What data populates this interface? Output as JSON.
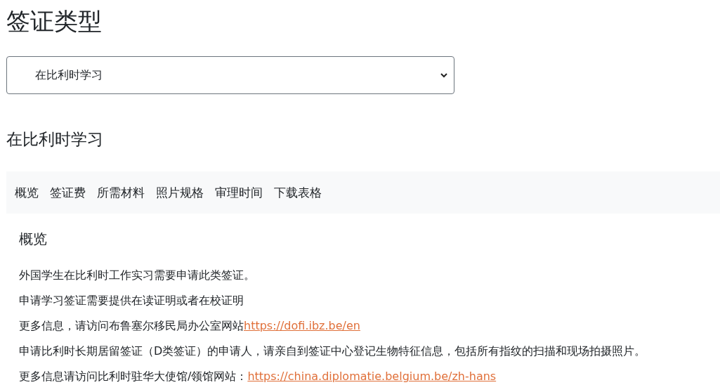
{
  "page_title": "签证类型",
  "visa_select": {
    "value": "在比利时学习"
  },
  "section_title": "在比利时学习",
  "tabs": [
    {
      "label": "概览"
    },
    {
      "label": "签证费"
    },
    {
      "label": "所需材料"
    },
    {
      "label": "照片规格"
    },
    {
      "label": "审理时间"
    },
    {
      "label": "下载表格"
    }
  ],
  "panel": {
    "heading": "概览",
    "paragraphs": [
      {
        "text": "外国学生在比利时工作实习需要申请此类签证。"
      },
      {
        "text": "申请学习签证需要提供在读证明或者在校证明"
      },
      {
        "text": "更多信息，请访问布鲁塞尔移民局办公室网站",
        "link": "https://dofi.ibz.be/en"
      },
      {
        "text": "申请比利时长期居留签证（D类签证）的申请人，请亲自到签证中心登记生物特征信息，包括所有指纹的扫描和现场拍摄照片。"
      },
      {
        "text": "更多信息请访问比利时驻华大使馆/领馆网站：",
        "link": "https://china.diplomatie.belgium.be/zh-hans"
      }
    ]
  }
}
